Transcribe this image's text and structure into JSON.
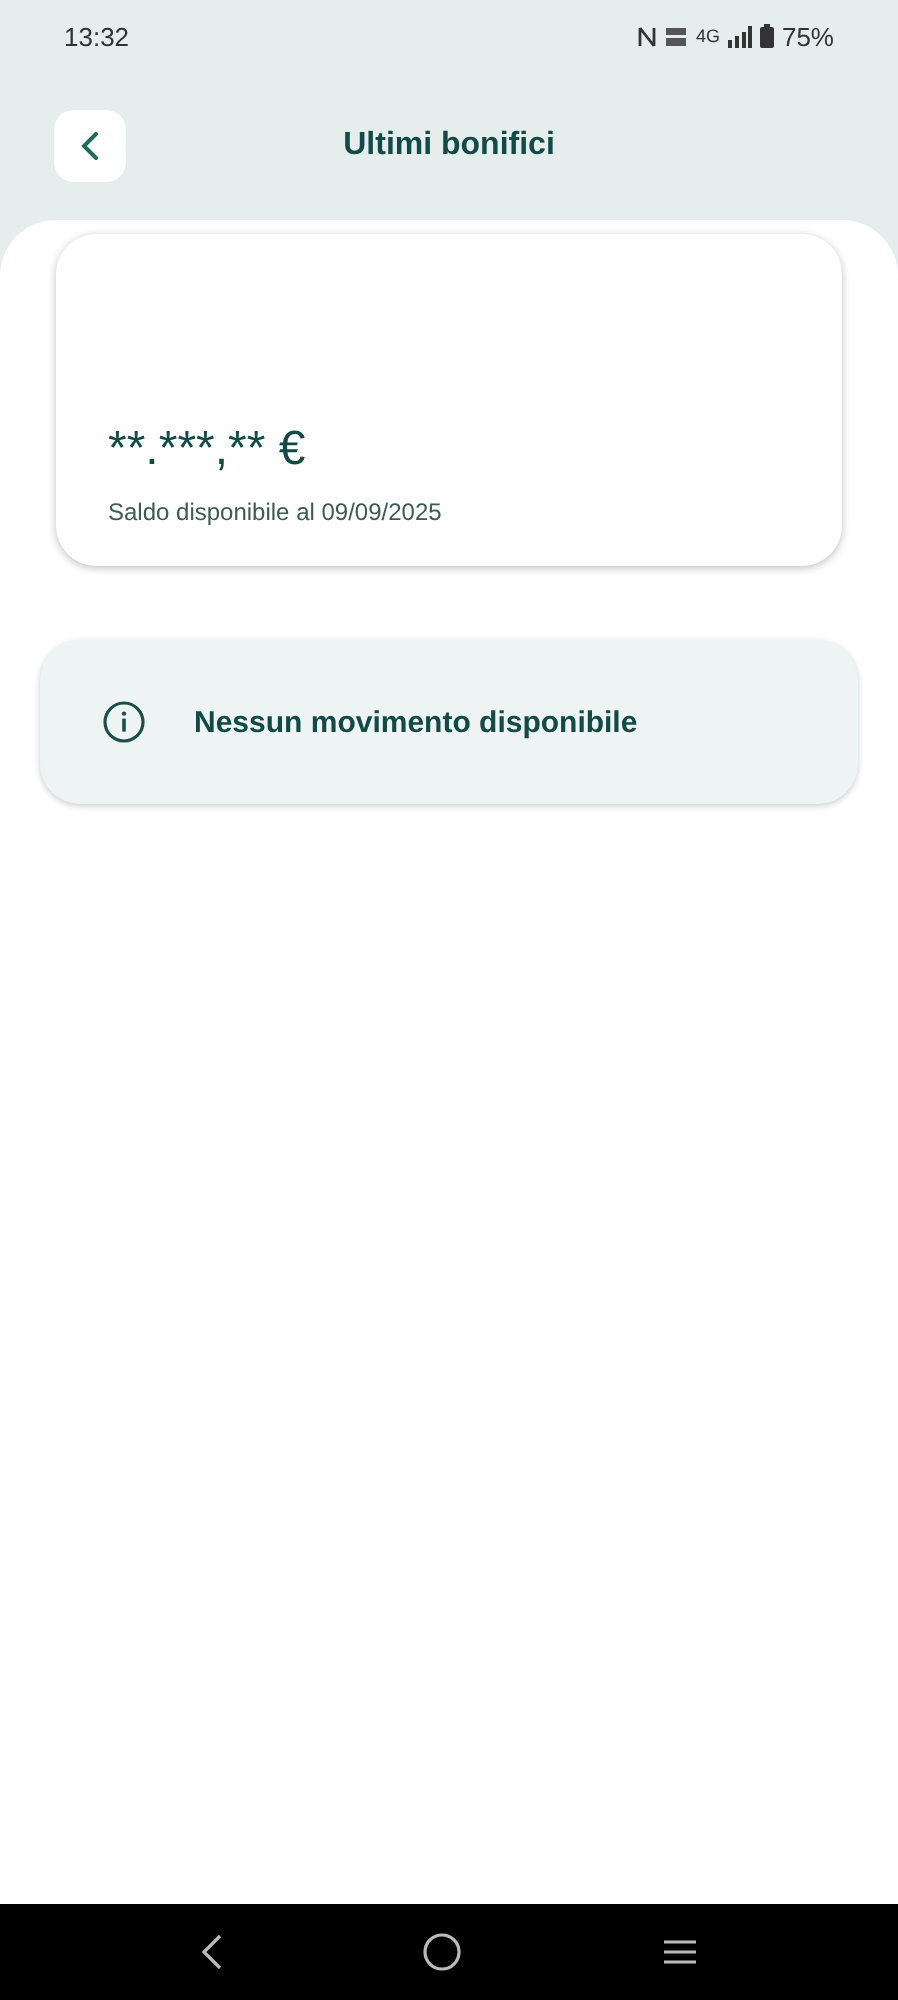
{
  "status_bar": {
    "time": "13:32",
    "network": "4G",
    "battery": "75%"
  },
  "header": {
    "title": "Ultimi bonifici"
  },
  "balance_card": {
    "amount": "**.***,** €",
    "caption": "Saldo disponibile al 09/09/2025"
  },
  "notice": {
    "text": "Nessun movimento disponibile"
  }
}
